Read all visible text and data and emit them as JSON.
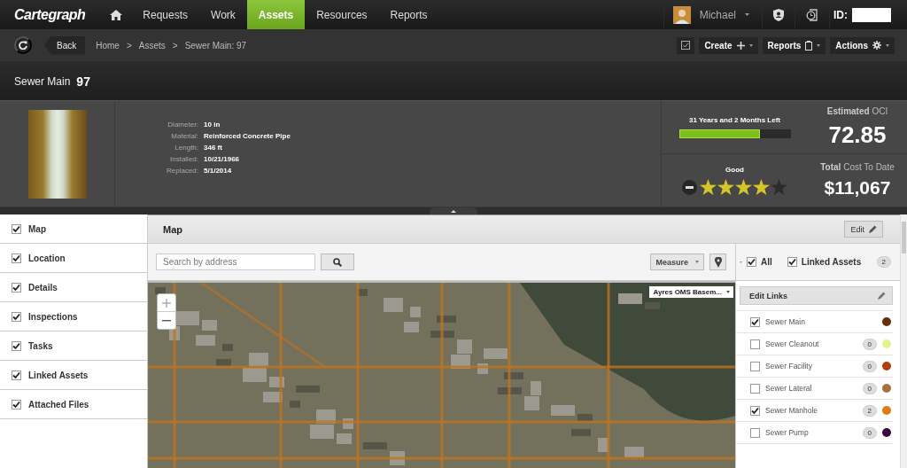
{
  "app": {
    "logo": "Cartegraph"
  },
  "nav": {
    "items": [
      {
        "label": "Requests",
        "selected": false
      },
      {
        "label": "Work",
        "selected": false
      },
      {
        "label": "Assets",
        "selected": true
      },
      {
        "label": "Resources",
        "selected": false
      },
      {
        "label": "Reports",
        "selected": false
      }
    ],
    "user": "Michael",
    "id_label": "ID:"
  },
  "toolbar": {
    "back": "Back",
    "breadcrumb": [
      "Home",
      "Assets",
      "Sewer Main: 97"
    ],
    "separator": ">",
    "buttons": [
      {
        "label": "Create",
        "kind": "create"
      },
      {
        "label": "Reports",
        "kind": "reports"
      },
      {
        "label": "Actions",
        "kind": "actions"
      }
    ]
  },
  "asset": {
    "type": "Sewer Main",
    "number": "97",
    "attributes": [
      {
        "label": "Diameter:",
        "value": "10 in"
      },
      {
        "label": "Material:",
        "value": "Reinforced Concrete Pipe"
      },
      {
        "label": "Length:",
        "value": "346 ft"
      },
      {
        "label": "Installed:",
        "value": "10/21/1966"
      },
      {
        "label": "Replaced:",
        "value": "5/1/2014"
      }
    ]
  },
  "life": {
    "label": "31 Years and 2 Months Left",
    "level": 0.73
  },
  "condition": {
    "label": "Good",
    "stars": 4
  },
  "oci": {
    "label": "**Estimated** OCI",
    "value": "72.85"
  },
  "cost": {
    "label": "**Total** Cost To Date",
    "value": "$11,067"
  },
  "sections": [
    {
      "label": "Map",
      "checked": true
    },
    {
      "label": "Location",
      "checked": true
    },
    {
      "label": "Details",
      "checked": true
    },
    {
      "label": "Inspections",
      "checked": true
    },
    {
      "label": "Tasks",
      "checked": true
    },
    {
      "label": "Linked Assets",
      "checked": true
    },
    {
      "label": "Attached Files",
      "checked": true
    }
  ],
  "map": {
    "title": "Map",
    "edit": "Edit",
    "search_placeholder": "Search by address",
    "measure": "Measure",
    "basemap": "Ayres OMS Basem..."
  },
  "links": {
    "all": {
      "label": "All",
      "checked": true
    },
    "linked": {
      "label": "Linked Assets",
      "checked": true,
      "count": "2"
    },
    "edit_links": "Edit Links",
    "items": [
      {
        "name": "Sewer Main",
        "checked": true,
        "color": "#6b2e0a"
      },
      {
        "name": "Sewer Cleanout",
        "checked": false,
        "count": "0",
        "color": "#e4f28c"
      },
      {
        "name": "Sewer Facility",
        "checked": false,
        "count": "0",
        "color": "#b23c0e"
      },
      {
        "name": "Sewer Lateral",
        "checked": false,
        "count": "0",
        "color": "#a8703e"
      },
      {
        "name": "Sewer Manhole",
        "checked": true,
        "count": "2",
        "color": "#e07a12"
      },
      {
        "name": "Sewer Pump",
        "checked": false,
        "count": "0",
        "color": "#3a0a3c"
      }
    ]
  }
}
